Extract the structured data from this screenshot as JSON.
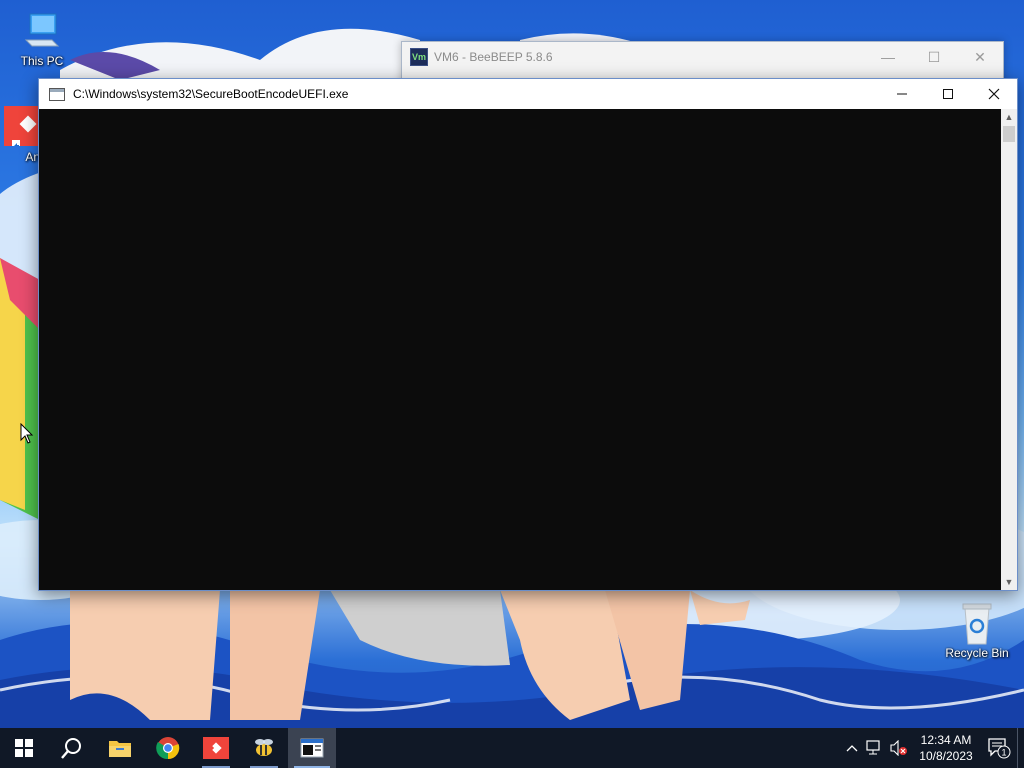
{
  "desktop": {
    "icons": [
      {
        "label": "This PC",
        "icon": "computer-icon"
      },
      {
        "label": "Any",
        "icon": "anydesk-icon"
      },
      {
        "label": "Recycle Bin",
        "icon": "recycle-bin-icon"
      }
    ]
  },
  "background_window": {
    "title": "VM6 - BeeBEEP 5.8.6",
    "icon": "Vm"
  },
  "console_window": {
    "title": "C:\\Windows\\system32\\SecureBootEncodeUEFI.exe",
    "controls": {
      "minimize": "minimize-icon",
      "maximize": "maximize-icon",
      "close": "close-icon"
    },
    "body_text": ""
  },
  "taskbar": {
    "items": [
      "start-icon",
      "search-icon",
      "file-explorer-icon",
      "chrome-icon",
      "anydesk-icon",
      "beebeep-icon",
      "console-icon"
    ],
    "clock": {
      "time": "12:34 AM",
      "date": "10/8/2023"
    },
    "notifications_count": "1"
  },
  "colors": {
    "taskbar": "#101826",
    "console_bg": "#0c0c0c",
    "accent": "#8fb4e6"
  }
}
